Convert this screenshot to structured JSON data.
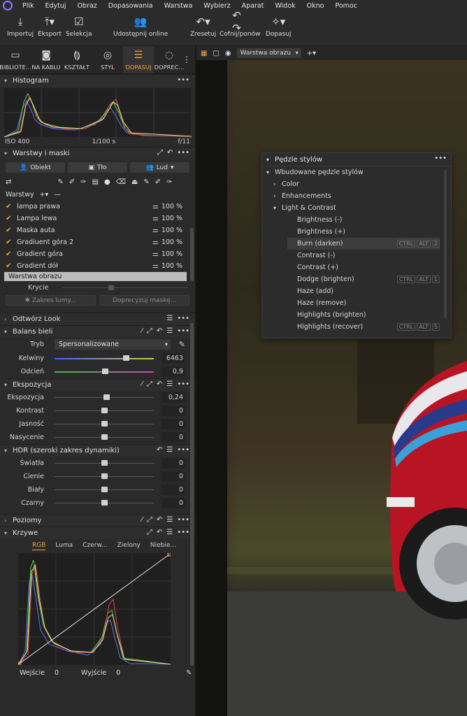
{
  "menubar": {
    "items": [
      "Plik",
      "Edytuj",
      "Obraz",
      "Dopasowania",
      "Warstwa",
      "Wybierz",
      "Aparat",
      "Widok",
      "Okno",
      "Pomoc"
    ]
  },
  "toolbar": {
    "import": "Importuj",
    "export": "Eksport",
    "select": "Selekcja",
    "share": "Udostępnij online",
    "reset": "Zresetuj",
    "undo": "Cofnij/ponów",
    "adjust": "Dopasuj"
  },
  "tool_tabs": [
    "BIBLIOTE...",
    "NA KABLU",
    "KSZTAŁT",
    "STYL",
    "DOPASUJ",
    "DOPREC..."
  ],
  "histogram": {
    "title": "Histogram",
    "iso": "ISO 400",
    "shutter": "1/100 s",
    "aperture": "f/11"
  },
  "layers": {
    "title": "Warstwy i maski",
    "tabs": [
      "Obiekt",
      "Tło",
      "Lud"
    ],
    "head_label": "Warstwy",
    "rows": [
      {
        "name": "lampa prawa",
        "opacity": "100 %"
      },
      {
        "name": "Lampa lewa",
        "opacity": "100 %"
      },
      {
        "name": "Maska auta",
        "opacity": "100 %"
      },
      {
        "name": "Gradiuent góra 2",
        "opacity": "100 %"
      },
      {
        "name": "Gradient góra",
        "opacity": "100 %"
      },
      {
        "name": "Gradient dół",
        "opacity": "100 %"
      }
    ],
    "selected": "Warstwa obrazu",
    "opacity_label": "Krycie",
    "btn_luma": "Zakres lumy...",
    "btn_refine": "Doprecyzuj maskę..."
  },
  "sections": {
    "look": "Odtwórz Look",
    "wb": "Balans bieli",
    "exposure": "Ekspozycja",
    "hdr": "HDR (szeroki zakres dynamiki)",
    "levels": "Poziomy",
    "curves": "Krzywe"
  },
  "wb": {
    "mode_label": "Tryb",
    "mode_value": "Spersonalizowane",
    "kelvin_label": "Kelwiny",
    "kelvin": "6463",
    "tint_label": "Odcień",
    "tint": "0,9"
  },
  "exposure": [
    {
      "name": "Ekspozycja",
      "value": "0,24"
    },
    {
      "name": "Kontrast",
      "value": "0"
    },
    {
      "name": "Jasność",
      "value": "0"
    },
    {
      "name": "Nasycenie",
      "value": "0"
    }
  ],
  "hdr": [
    {
      "name": "Światła",
      "value": "0"
    },
    {
      "name": "Cienie",
      "value": "0"
    },
    {
      "name": "Biały",
      "value": "0"
    },
    {
      "name": "Czarny",
      "value": "0"
    }
  ],
  "curves": {
    "tabs": [
      "RGB",
      "Luma",
      "Czerw...",
      "Zielony",
      "Niebie..."
    ],
    "input_label": "Wejście",
    "input": "0",
    "output_label": "Wyjście",
    "output": "0"
  },
  "viewer": {
    "layer_select": "Warstwa obrazu"
  },
  "brushes": {
    "title": "Pędzle stylów",
    "root": "Wbudowane pędzle stylów",
    "groups": [
      "Color",
      "Enhancements",
      "Light & Contrast"
    ],
    "items": [
      {
        "name": "Brightness (-)"
      },
      {
        "name": "Brightness (+)"
      },
      {
        "name": "Burn (darken)",
        "keys": [
          "CTRL",
          "ALT",
          "2"
        ],
        "highlight": true
      },
      {
        "name": "Contrast (-)"
      },
      {
        "name": "Contrast (+)"
      },
      {
        "name": "Dodge (brighten)",
        "keys": [
          "CTRL",
          "ALT",
          "1"
        ]
      },
      {
        "name": "Haze (add)"
      },
      {
        "name": "Haze (remove)"
      },
      {
        "name": "Highlights (brighten)"
      },
      {
        "name": "Highlights (recover)",
        "keys": [
          "CTRL",
          "ALT",
          "5"
        ]
      }
    ]
  },
  "colors": {
    "accent": "#f0a73a",
    "panel": "#2a2a2a",
    "menubar": "#2b2b2b"
  }
}
